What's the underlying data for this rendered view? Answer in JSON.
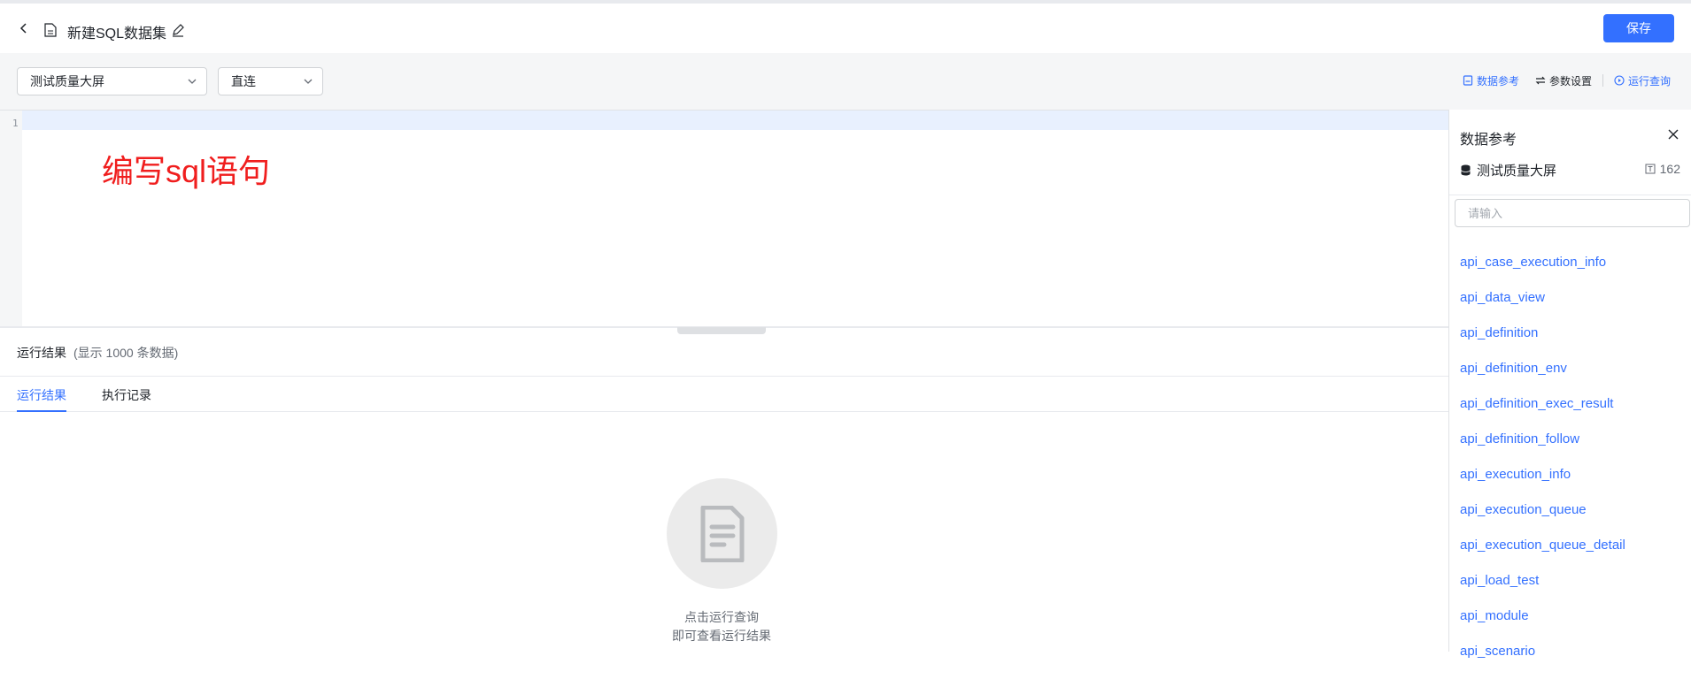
{
  "header": {
    "title": "新建SQL数据集",
    "save_label": "保存"
  },
  "toolbar": {
    "datasource": "测试质量大屏",
    "mode": "直连",
    "data_ref_label": "数据参考",
    "param_label": "参数设置",
    "run_label": "运行查询"
  },
  "editor": {
    "line_number": "1",
    "hint": "编写sql语句"
  },
  "results": {
    "title": "运行结果",
    "subtitle": "(显示 1000 条数据)",
    "tabs": [
      {
        "label": "运行结果"
      },
      {
        "label": "执行记录"
      }
    ],
    "empty_line1": "点击运行查询",
    "empty_line2": "即可查看运行结果"
  },
  "panel": {
    "title": "数据参考",
    "db_name": "测试质量大屏",
    "table_count": "162",
    "search_placeholder": "请输入",
    "tables": [
      "api_case_execution_info",
      "api_data_view",
      "api_definition",
      "api_definition_env",
      "api_definition_exec_result",
      "api_definition_follow",
      "api_execution_info",
      "api_execution_queue",
      "api_execution_queue_detail",
      "api_load_test",
      "api_module",
      "api_scenario"
    ]
  },
  "colors": {
    "primary": "#3370ff",
    "hint_red": "#f01e1e"
  }
}
